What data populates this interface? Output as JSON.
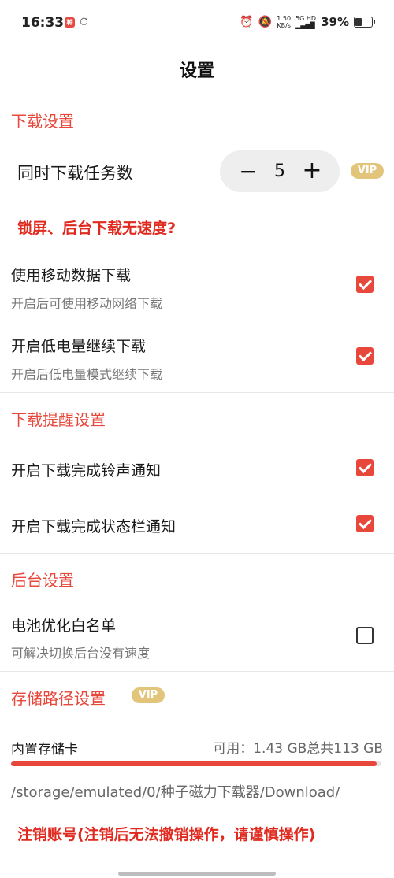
{
  "status_bar": {
    "time": "16:33",
    "app_badge": "种",
    "speed_value": "1.50",
    "speed_unit": "KB/s",
    "network": "5G HD",
    "battery_percent": "39%",
    "battery_level": 0.39
  },
  "page_title": "设置",
  "download_settings": {
    "section_title": "下载设置",
    "concurrent_label": "同时下载任务数",
    "concurrent_value": "5",
    "minus": "−",
    "plus": "+",
    "vip": "VIP",
    "lock_screen_link": "锁屏、后台下载无速度?",
    "mobile_data_title": "使用移动数据下载",
    "mobile_data_sub": "开启后可使用移动网络下载",
    "mobile_data_checked": true,
    "low_power_title": "开启低电量继续下载",
    "low_power_sub": "开启后低电量模式继续下载",
    "low_power_checked": true
  },
  "reminder_settings": {
    "section_title": "下载提醒设置",
    "ringtone_title": "开启下载完成铃声通知",
    "ringtone_checked": true,
    "statusbar_title": "开启下载完成状态栏通知",
    "statusbar_checked": true
  },
  "background_settings": {
    "section_title": "后台设置",
    "battery_title": "电池优化白名单",
    "battery_sub": "可解决切换后台没有速度",
    "battery_checked": false
  },
  "storage_settings": {
    "section_title": "存储路径设置",
    "vip": "VIP",
    "storage_label": "内置存储卡",
    "storage_free": "可用：1.43 GB总共113 GB",
    "used_fraction": 0.987,
    "path": "/storage/emulated/0/种子磁力下载器/Download/"
  },
  "cancel_account_link": "注销账号(注销后无法撤销操作，请谨慎操作)",
  "colors": {
    "accent": "#e8473b",
    "link": "#e02a1f",
    "vip": "#e2c57a"
  }
}
